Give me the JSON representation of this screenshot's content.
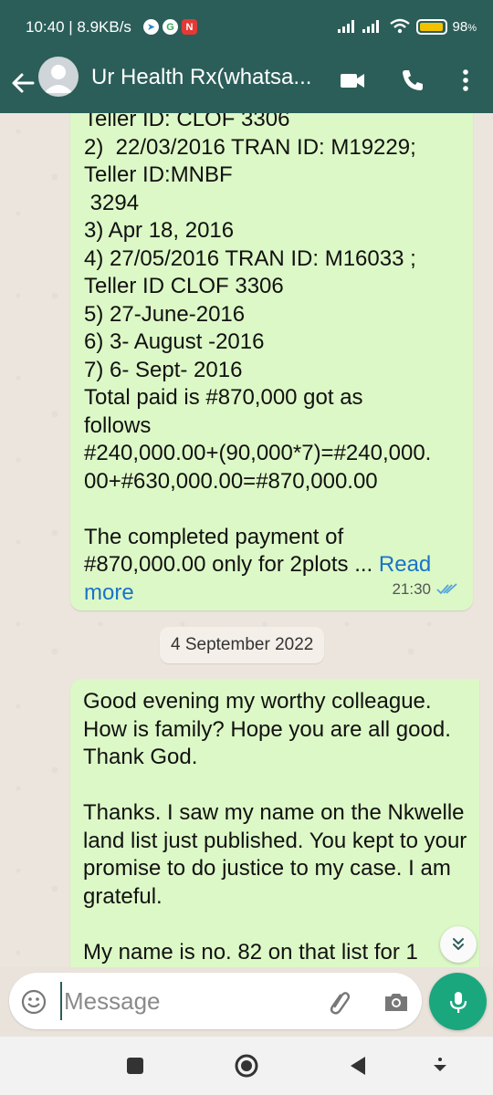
{
  "status": {
    "time": "10:40 | 8.9KB/s",
    "battery": "98",
    "battery_unit": "%",
    "battery_level": 0.98
  },
  "header": {
    "contact_name": "Ur Health Rx(whatsa...",
    "accent": "#2b5e59"
  },
  "messages": {
    "first": {
      "lines": [
        "Teller ID: CLOF 3306",
        "2)  22/03/2016 TRAN ID: M19229;",
        "Teller ID:MNBF",
        " 3294",
        "3) Apr 18, 2016",
        "4) 27/05/2016 TRAN ID: M16033 ;",
        "Teller ID CLOF 3306",
        "5) 27-June-2016",
        "6) 3- August -2016",
        "7) 6- Sept- 2016",
        "Total paid is #870,000 got as",
        "follows",
        "#240,000.00+(90,000*7)=#240,000.",
        "00+#630,000.00=#870,000.00",
        "",
        "The completed payment of",
        "#870,000.00 only for 2plots ... "
      ],
      "read_more_1": "Read",
      "read_more_2": "more",
      "time": "21:30"
    },
    "date_chip": "4 September 2022",
    "second": {
      "para1": "Good evening my worthy colleague. How is family? Hope you are all good. Thank God.",
      "para2": "Thanks. I saw my name on the Nkwelle land list just published. You kept to your promise to do justice to my case. I am grateful.",
      "para3": "My name is no. 82 on that list for 1"
    }
  },
  "composer": {
    "placeholder": "Message"
  },
  "colors": {
    "bubble_out": "#dcf8c6",
    "mic": "#1aa77e",
    "read_ticks": "#4fa3e0",
    "link": "#1a73c7"
  }
}
